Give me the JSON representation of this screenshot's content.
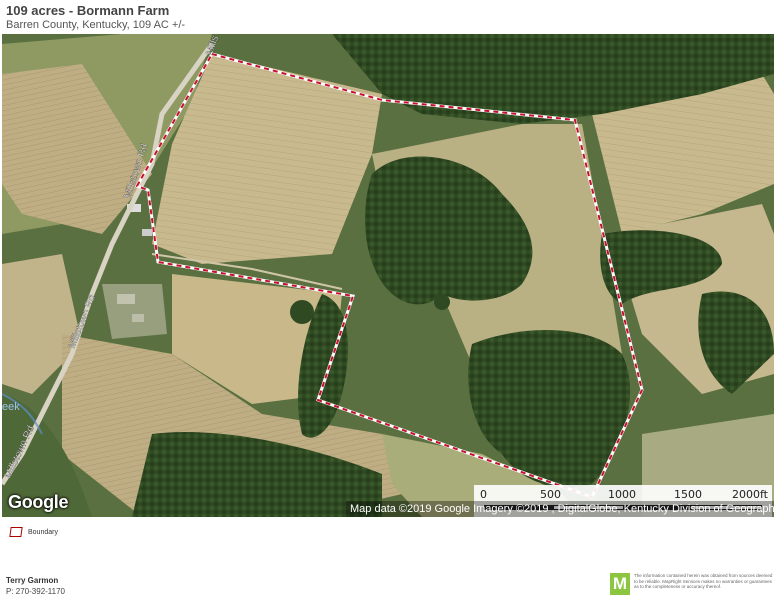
{
  "header": {
    "title": "109 acres - Bormann Farm",
    "subtitle": "Barren County, Kentucky, 109 AC +/-"
  },
  "map": {
    "provider_logo": "Google",
    "attribution": "Map data ©2019 Google  Imagery ©2019 , DigitalGlobe, Kentucky Division of Geographic Information, USDA Farm Service Agency",
    "roads": [
      "Millstown Rd",
      "Millstown Rd",
      "Millstown Rd",
      "Mills"
    ],
    "creek_label": "eek",
    "boundary_color": "#c8102e",
    "scale": {
      "labels": [
        "0",
        "500",
        "1000",
        "1500",
        "2000ft"
      ]
    }
  },
  "legend": {
    "items": [
      {
        "label": "Boundary",
        "icon": "boundary-polygon-icon"
      }
    ]
  },
  "footer": {
    "agent_name": "Terry Garmon",
    "agent_phone": "P: 270-392-1170",
    "brand_logo_letter": "M",
    "disclaimer": "The information contained herein was obtained from sources deemed to be reliable. MapRight Services makes no warranties or guarantees as to the completeness or accuracy thereof."
  }
}
